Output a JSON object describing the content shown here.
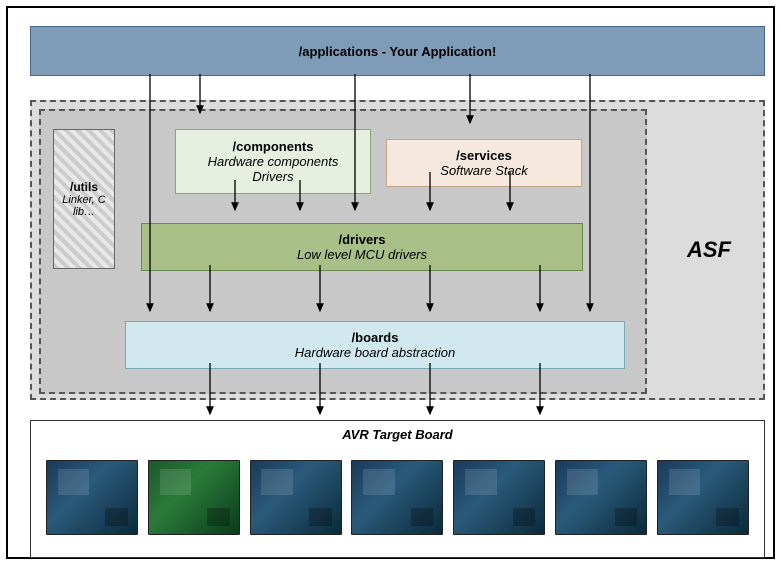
{
  "applications": {
    "title": "/applications - Your Application!"
  },
  "asf": {
    "label": "ASF"
  },
  "utils": {
    "title": "/utils",
    "sub": "Linker, C lib…"
  },
  "components": {
    "title": "/components",
    "sub1": "Hardware components",
    "sub2": "Drivers"
  },
  "services": {
    "title": "/services",
    "sub": "Software Stack"
  },
  "drivers": {
    "title": "/drivers",
    "sub": "Low level MCU drivers"
  },
  "boards": {
    "title": "/boards",
    "sub": "Hardware board abstraction"
  },
  "target": {
    "label": "AVR Target Board"
  }
}
